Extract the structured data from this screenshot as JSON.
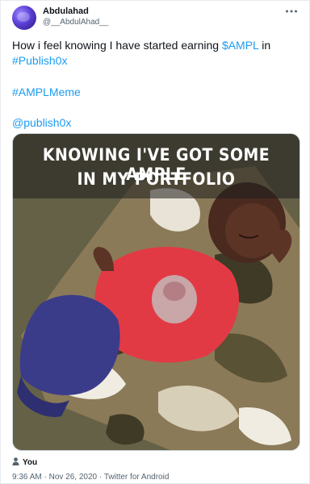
{
  "author": {
    "display_name": "Abdulahad",
    "handle": "@__AbdulAhad__"
  },
  "tweet": {
    "text_plain_1": "How i feel knowing I have started earning ",
    "cashtag": "$AMPL",
    "text_plain_2": " in",
    "hashtag_1": "#Publish0x",
    "hashtag_2": "#AMPLMeme",
    "mention": "@publish0x"
  },
  "media": {
    "caption_line_1": "KNOWING I'VE GOT SOME AMPLE",
    "caption_line_2": "IN MY PORTFOLIO",
    "alt_subject": "sleeping baby on camouflage pillow"
  },
  "tagged": {
    "label": "You"
  },
  "meta": {
    "time": "9:36 AM",
    "separator": " · ",
    "date": "Nov 26, 2020",
    "source": "Twitter for Android"
  },
  "colors": {
    "link": "#1d9bf0",
    "secondary": "#536471",
    "primary": "#0f1419"
  }
}
